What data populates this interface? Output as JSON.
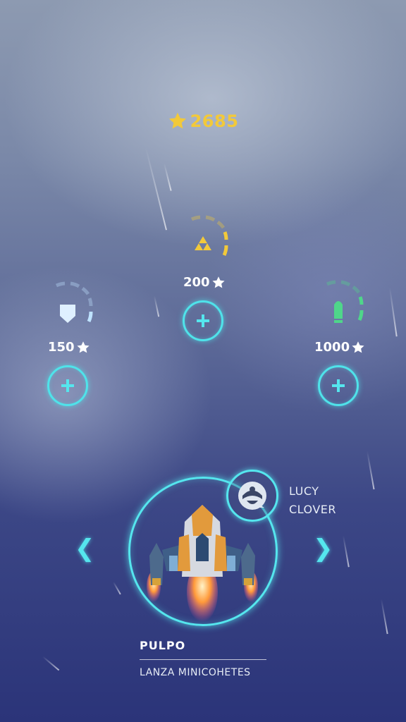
{
  "score": {
    "value": "2685",
    "icon": "star-icon",
    "color": "#f2c93a"
  },
  "upgrades": {
    "shield": {
      "icon": "shield-icon",
      "cost": "150",
      "level": 1,
      "max_level": 5,
      "color": "#bfe3ff"
    },
    "power": {
      "icon": "triforce-icon",
      "cost": "200",
      "level": 2,
      "max_level": 5,
      "color": "#f2c93a"
    },
    "ammo": {
      "icon": "bullet-icon",
      "cost": "1000",
      "level": 2,
      "max_level": 5,
      "color": "#4fd68a"
    }
  },
  "pilot": {
    "first_name": "LUCY",
    "last_name": "CLOVER"
  },
  "ship": {
    "name": "PULPO",
    "weapon": "LANZA MINICOHETES"
  },
  "navigation": {
    "prev": "❮",
    "next": "❯"
  },
  "colors": {
    "accent": "#55e6ee"
  }
}
